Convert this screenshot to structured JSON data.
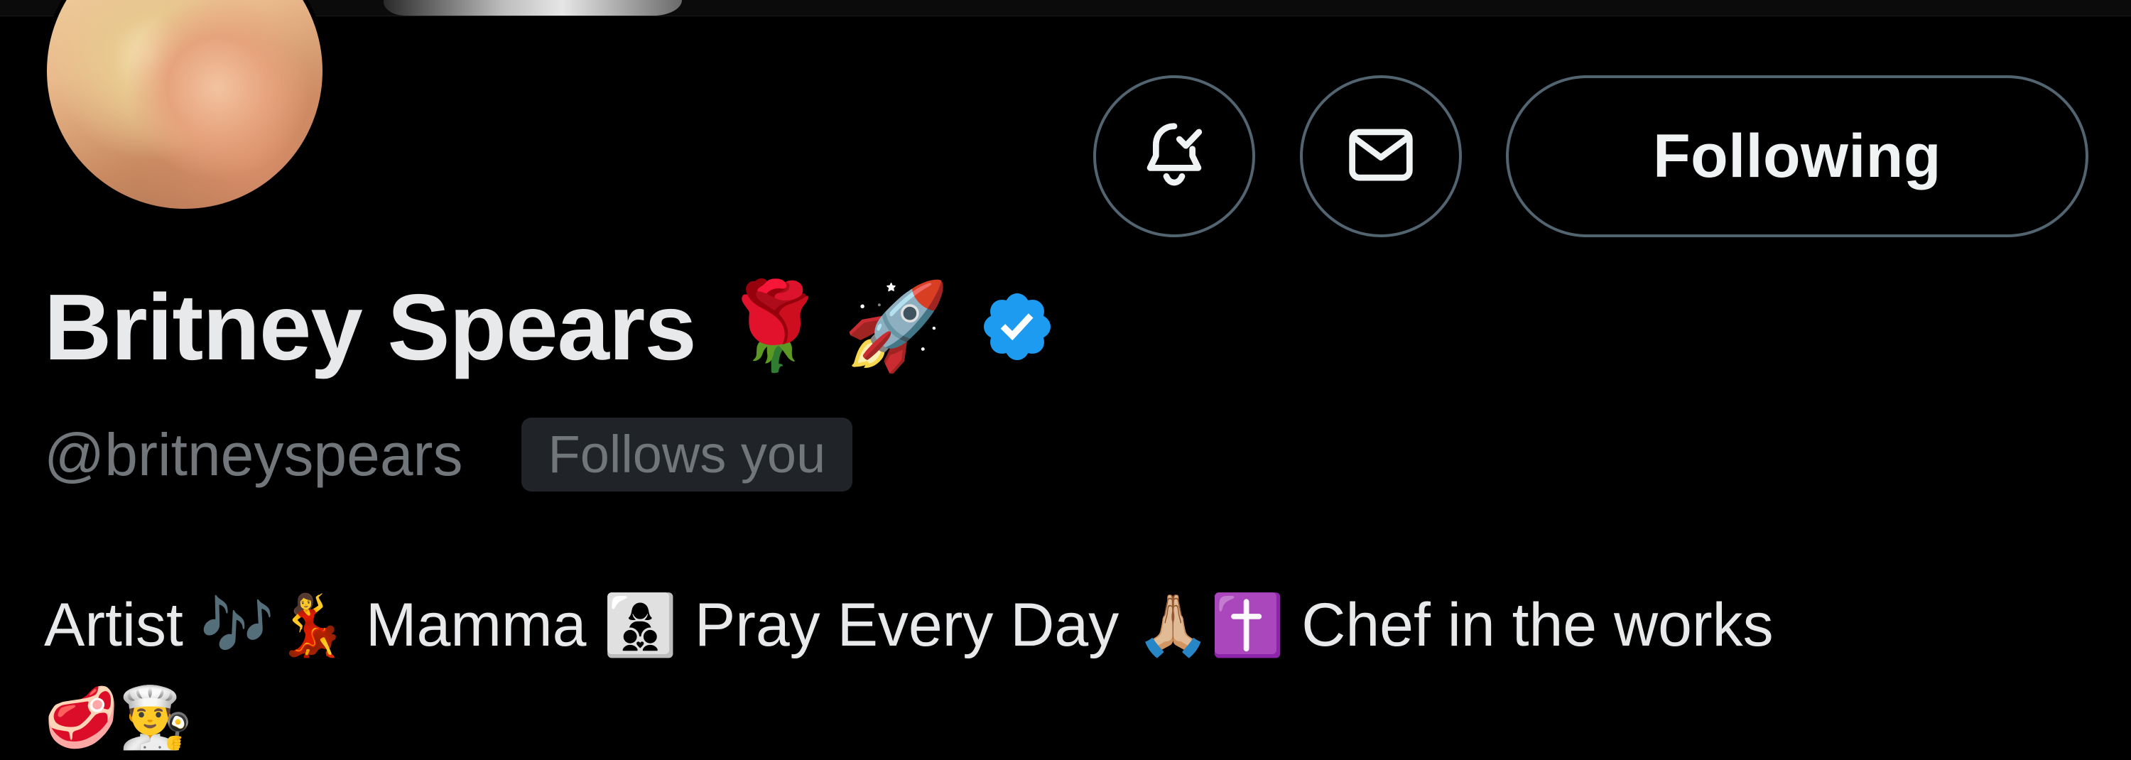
{
  "profile": {
    "display_name": "Britney Spears",
    "name_emojis": [
      "🌹",
      "🚀"
    ],
    "verified_icon": "verified-badge-icon",
    "handle": "@britneyspears",
    "follows_you_label": "Follows you",
    "bio": {
      "line1": [
        {
          "type": "text",
          "value": "Artist "
        },
        {
          "type": "emoji",
          "value": "🎶"
        },
        {
          "type": "emoji",
          "value": "💃"
        },
        {
          "type": "text",
          "value": " Mamma "
        },
        {
          "type": "emoji",
          "value": "👩‍👦‍👦"
        },
        {
          "type": "text",
          "value": " Pray Every Day "
        },
        {
          "type": "emoji",
          "value": "🙏🏼"
        },
        {
          "type": "emoji",
          "value": "✝️"
        },
        {
          "type": "text",
          "value": " Chef in the works"
        }
      ],
      "line2": [
        "🥩",
        "👨‍🍳"
      ]
    }
  },
  "actions": {
    "notify_icon": "bell-check-icon",
    "message_icon": "envelope-icon",
    "following_label": "Following"
  },
  "colors": {
    "background": "#000000",
    "text_primary": "#e7e9ea",
    "text_secondary": "#71767b",
    "button_border": "#536471",
    "verified_blue": "#1d9bf0",
    "badge_bg": "#202327"
  }
}
